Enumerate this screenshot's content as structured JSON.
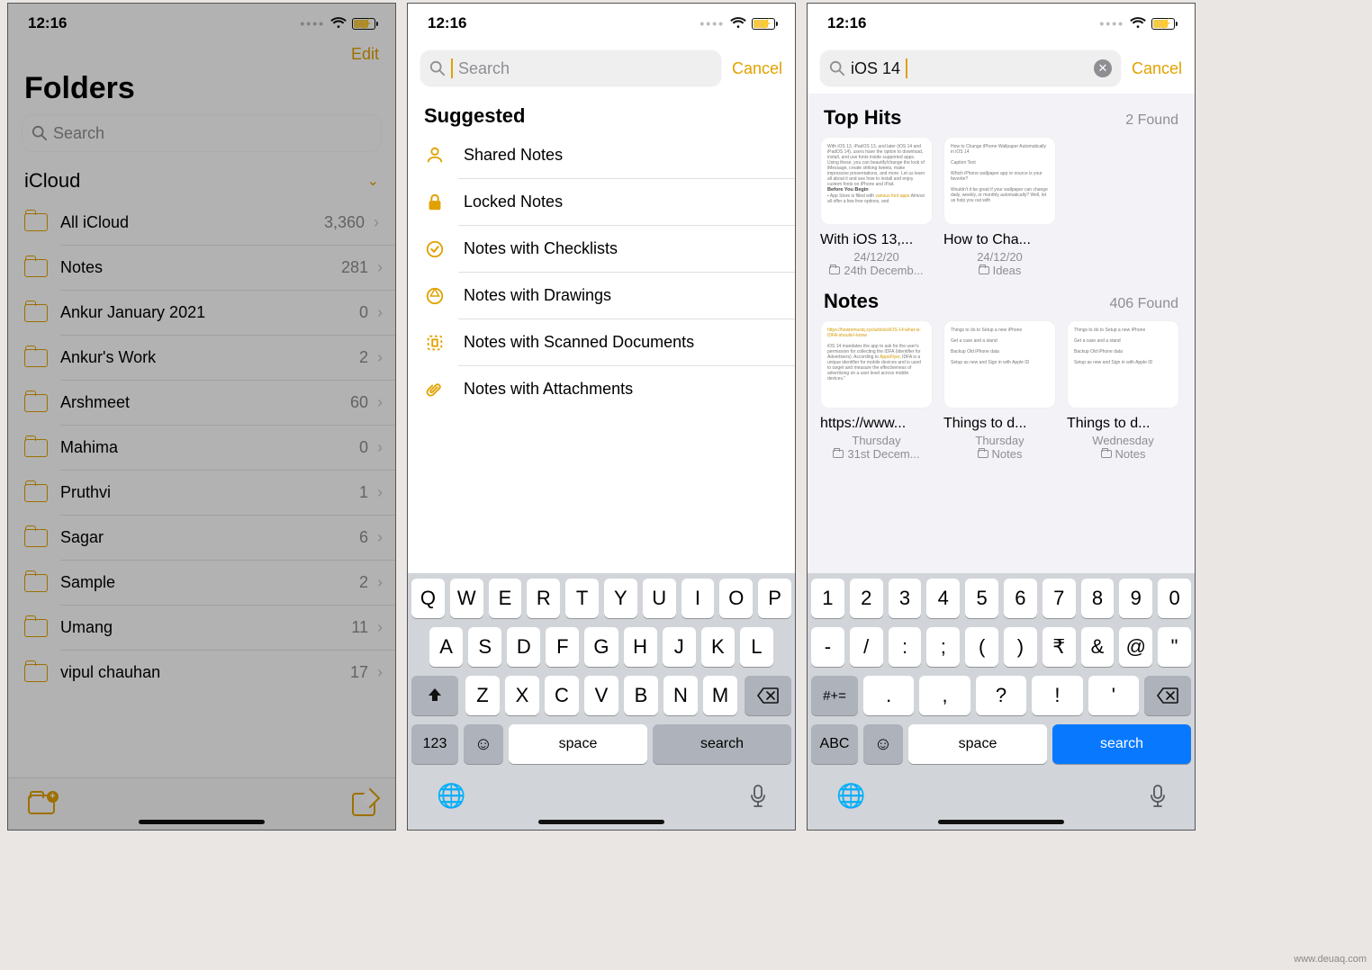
{
  "status": {
    "time": "12:16"
  },
  "phone1": {
    "edit_label": "Edit",
    "title": "Folders",
    "search_placeholder": "Search",
    "section": "iCloud",
    "folders": [
      {
        "name": "All iCloud",
        "count": "3,360"
      },
      {
        "name": "Notes",
        "count": "281"
      },
      {
        "name": "Ankur January 2021",
        "count": "0"
      },
      {
        "name": "Ankur's Work",
        "count": "2"
      },
      {
        "name": "Arshmeet",
        "count": "60"
      },
      {
        "name": "Mahima",
        "count": "0"
      },
      {
        "name": "Pruthvi",
        "count": "1"
      },
      {
        "name": "Sagar",
        "count": "6"
      },
      {
        "name": "Sample",
        "count": "2"
      },
      {
        "name": "Umang",
        "count": "11"
      },
      {
        "name": "vipul chauhan",
        "count": "17"
      }
    ]
  },
  "phone2": {
    "search_placeholder": "Search",
    "cancel_label": "Cancel",
    "suggested_heading": "Suggested",
    "suggested": [
      "Shared Notes",
      "Locked Notes",
      "Notes with Checklists",
      "Notes with Drawings",
      "Notes with Scanned Documents",
      "Notes with Attachments"
    ],
    "kb_rows": {
      "r1": [
        "Q",
        "W",
        "E",
        "R",
        "T",
        "Y",
        "U",
        "I",
        "O",
        "P"
      ],
      "r2": [
        "A",
        "S",
        "D",
        "F",
        "G",
        "H",
        "J",
        "K",
        "L"
      ],
      "r3": [
        "Z",
        "X",
        "C",
        "V",
        "B",
        "N",
        "M"
      ],
      "mode": "123",
      "space": "space",
      "search": "search"
    }
  },
  "phone3": {
    "search_value": "iOS 14",
    "cancel_label": "Cancel",
    "top_hits": {
      "title": "Top Hits",
      "found": "2 Found",
      "cards": [
        {
          "title": "With iOS 13,...",
          "date": "24/12/20",
          "loc": "24th Decemb..."
        },
        {
          "title": "How to Cha...",
          "date": "24/12/20",
          "loc": "Ideas"
        }
      ]
    },
    "notes": {
      "title": "Notes",
      "found": "406 Found",
      "cards": [
        {
          "title": "https://www...",
          "date": "Thursday",
          "loc": "31st Decem..."
        },
        {
          "title": "Things to d...",
          "date": "Thursday",
          "loc": "Notes"
        },
        {
          "title": "Things to d...",
          "date": "Wednesday",
          "loc": "Notes"
        }
      ]
    },
    "kb_rows": {
      "r1": [
        "1",
        "2",
        "3",
        "4",
        "5",
        "6",
        "7",
        "8",
        "9",
        "0"
      ],
      "r2": [
        "-",
        "/",
        ":",
        ";",
        "(",
        ")",
        "₹",
        "&",
        "@",
        "\""
      ],
      "r3": [
        ".",
        ",",
        "?",
        "!",
        "'"
      ],
      "mode_left": "#+=",
      "mode_abc": "ABC",
      "space": "space",
      "search": "search"
    }
  }
}
